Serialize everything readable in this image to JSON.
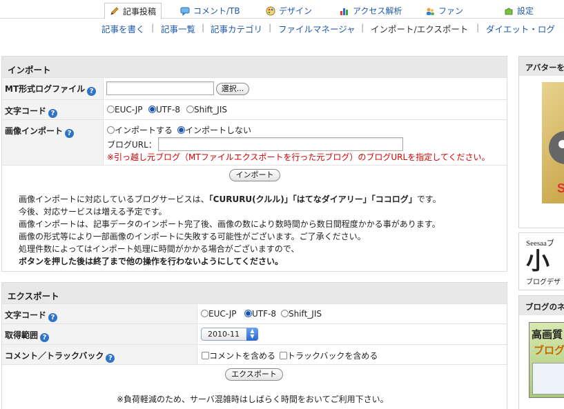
{
  "topnav": {
    "tabs": [
      {
        "label": "記事投稿",
        "icon": "pencil-icon",
        "active": true
      },
      {
        "label": "コメント/TB",
        "icon": "comment-icon"
      },
      {
        "label": "デザイン",
        "icon": "palette-icon"
      },
      {
        "label": "アクセス解析",
        "icon": "bar-chart-icon"
      },
      {
        "label": "ファン",
        "icon": "users-icon"
      },
      {
        "label": "設定",
        "icon": "puzzle-icon"
      }
    ]
  },
  "subnav": [
    "記事を書く",
    "記事一覧",
    "記事カテゴリ",
    "ファイルマネージャ",
    "インポート/エクスポート",
    "ダイエット・ログ"
  ],
  "import": {
    "title": "インポート",
    "mt_file_label": "MT形式ログファイル",
    "choose_button": "選択...",
    "charset_label": "文字コード",
    "charset_options": [
      "EUC-JP",
      "UTF-8",
      "Shift_JIS"
    ],
    "charset_selected": "UTF-8",
    "image_import_label": "画像インポート",
    "image_options": [
      "インポートする",
      "インポートしない"
    ],
    "image_selected": "インポートしない",
    "blog_url_label": "ブログURL：",
    "blog_url_note": "※引っ越し元ブログ（MTファイルエクスポートを行った元ブログ）のブログURLを指定してください。",
    "import_button": "インポート",
    "notes": {
      "line1_prefix": "画像インポートに対応しているブログサービスは、",
      "line1_services": "「CURURU(クルル)」「はてなダイアリー」「ココログ」",
      "line1_suffix": "です。",
      "line2": "今後、対応サービスは増える予定です。",
      "line3": "画像インポートは、記事データのインポート完了後、画像の数により数時間から数日間程度かかる事があります。",
      "line4": "画像の形式等により一部画像のインポートに失敗する可能性がございます。ご了承ください。",
      "line5": "処理件数によってはインポート処理に時間がかかる場合がございますので、",
      "line6": "ボタンを押した後は終了まで他の操作を行わないようにしてください。"
    }
  },
  "export": {
    "title": "エクスポート",
    "charset_label": "文字コード",
    "charset_options": [
      "EUC-JP",
      "UTF-8",
      "Shift_JIS"
    ],
    "charset_selected": "UTF-8",
    "range_label": "取得範囲",
    "range_value": "2010-11",
    "comment_tb_label": "コメント／トラックバック",
    "include_comments": "コメントを含める",
    "include_trackbacks": "トラックバックを含める",
    "export_button": "エクスポート",
    "note": "※負荷軽減のため、サーバ混雑時はしばらく時間をおいてご利用下さい。"
  },
  "sidebar": {
    "avatar_head": "アバターを",
    "seesaa_text": "Seesaaブ",
    "big_char": "小",
    "design_text": "ブログデザ",
    "blog_news_head": "ブログのネ",
    "banner_text_1": "高画質",
    "banner_text_2": "ブログ"
  },
  "colors": {
    "link": "#1f5aa8",
    "accent_red": "#d40000",
    "help_blue": "#2f74c9"
  }
}
